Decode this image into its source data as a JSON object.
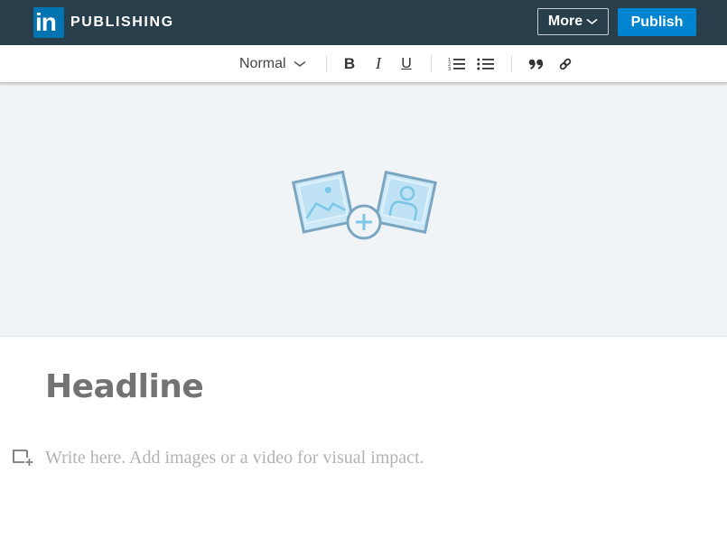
{
  "header": {
    "logo_text": "in",
    "brand_label": "PUBLISHING",
    "more_label": "More",
    "publish_label": "Publish",
    "colors": {
      "bar": "#283e4a",
      "logo": "#0073b1",
      "publish": "#0084cf"
    }
  },
  "toolbar": {
    "style_select": "Normal",
    "bold_label": "B",
    "italic_label": "I",
    "underline_label": "U",
    "icons": [
      "chevron-down-icon",
      "numbered-list-icon",
      "bulleted-list-icon",
      "quote-icon",
      "link-icon"
    ]
  },
  "cover": {
    "icon": "add-cover-image-icon"
  },
  "editor": {
    "headline_placeholder": "Headline",
    "body_placeholder": "Write here. Add images or a video for visual impact.",
    "add_media_icon": "add-media-icon"
  }
}
